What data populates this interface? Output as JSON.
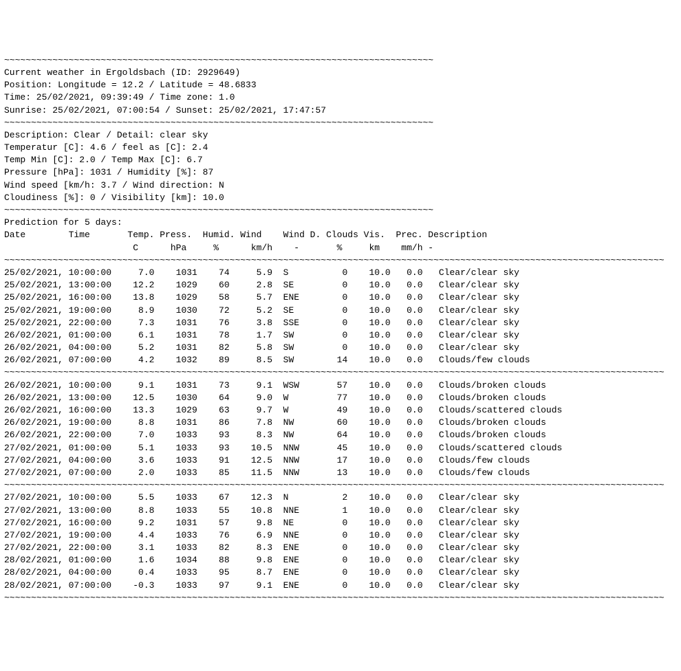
{
  "sep": "~~~~~~~~~~~~~~~~~~~~~~~~~~~~~~~~~~~~~~~~~~~~~~~~~~~~~~~~~~~~~~~~~~~~~~~~~~~~~~~~",
  "sep_long": "~~~~~~~~~~~~~~~~~~~~~~~~~~~~~~~~~~~~~~~~~~~~~~~~~~~~~~~~~~~~~~~~~~~~~~~~~~~~~~~~~~~~~~~~~~~~~~~~~~~~~~~~~~~~~~~~~~~~~~~~~~~",
  "header": {
    "title": "Current weather in Ergoldsbach (ID: 2929649)",
    "position": "Position: Longitude = 12.2 / Latitude = 48.6833",
    "time": "Time: 25/02/2021, 09:39:49 / Time zone: 1.0",
    "sun": "Sunrise: 25/02/2021, 07:00:54 / Sunset: 25/02/2021, 17:47:57"
  },
  "current": {
    "description": "Description: Clear / Detail: clear sky",
    "temp": "Temperatur [C]: 4.6 / feel as [C]: 2.4",
    "tempminmax": "Temp Min [C]: 2.0 / Temp Max [C]: 6.7",
    "pressure": "Pressure [hPa]: 1031 / Humidity [%]: 87",
    "wind": "Wind speed [km/h: 3.7 / Wind direction: N",
    "clouds": "Cloudiness [%]: 0 / Visibility [km]: 10.0"
  },
  "prediction_label": "Prediction for 5 days:",
  "columns": {
    "row1": [
      "Date",
      "Time",
      "Temp.",
      "Press.",
      "Humid.",
      "Wind",
      "Wind D.",
      "Clouds",
      "Vis.",
      "Prec.",
      "Description"
    ],
    "row2": [
      "",
      "",
      "C",
      "hPa",
      "%",
      "km/h",
      "-",
      "%",
      "km",
      "mm/h",
      "-"
    ]
  },
  "blocks": [
    [
      {
        "date": "25/02/2021,",
        "time": "10:00:00",
        "temp": "7.0",
        "press": "1031",
        "humid": "74",
        "wind": "5.9",
        "windd": "S",
        "clouds": "0",
        "vis": "10.0",
        "prec": "0.0",
        "desc": "Clear/clear sky"
      },
      {
        "date": "25/02/2021,",
        "time": "13:00:00",
        "temp": "12.2",
        "press": "1029",
        "humid": "60",
        "wind": "2.8",
        "windd": "SE",
        "clouds": "0",
        "vis": "10.0",
        "prec": "0.0",
        "desc": "Clear/clear sky"
      },
      {
        "date": "25/02/2021,",
        "time": "16:00:00",
        "temp": "13.8",
        "press": "1029",
        "humid": "58",
        "wind": "5.7",
        "windd": "ENE",
        "clouds": "0",
        "vis": "10.0",
        "prec": "0.0",
        "desc": "Clear/clear sky"
      },
      {
        "date": "25/02/2021,",
        "time": "19:00:00",
        "temp": "8.9",
        "press": "1030",
        "humid": "72",
        "wind": "5.2",
        "windd": "SE",
        "clouds": "0",
        "vis": "10.0",
        "prec": "0.0",
        "desc": "Clear/clear sky"
      },
      {
        "date": "25/02/2021,",
        "time": "22:00:00",
        "temp": "7.3",
        "press": "1031",
        "humid": "76",
        "wind": "3.8",
        "windd": "SSE",
        "clouds": "0",
        "vis": "10.0",
        "prec": "0.0",
        "desc": "Clear/clear sky"
      },
      {
        "date": "26/02/2021,",
        "time": "01:00:00",
        "temp": "6.1",
        "press": "1031",
        "humid": "78",
        "wind": "1.7",
        "windd": "SW",
        "clouds": "0",
        "vis": "10.0",
        "prec": "0.0",
        "desc": "Clear/clear sky"
      },
      {
        "date": "26/02/2021,",
        "time": "04:00:00",
        "temp": "5.2",
        "press": "1031",
        "humid": "82",
        "wind": "5.8",
        "windd": "SW",
        "clouds": "0",
        "vis": "10.0",
        "prec": "0.0",
        "desc": "Clear/clear sky"
      },
      {
        "date": "26/02/2021,",
        "time": "07:00:00",
        "temp": "4.2",
        "press": "1032",
        "humid": "89",
        "wind": "8.5",
        "windd": "SW",
        "clouds": "14",
        "vis": "10.0",
        "prec": "0.0",
        "desc": "Clouds/few clouds"
      }
    ],
    [
      {
        "date": "26/02/2021,",
        "time": "10:00:00",
        "temp": "9.1",
        "press": "1031",
        "humid": "73",
        "wind": "9.1",
        "windd": "WSW",
        "clouds": "57",
        "vis": "10.0",
        "prec": "0.0",
        "desc": "Clouds/broken clouds"
      },
      {
        "date": "26/02/2021,",
        "time": "13:00:00",
        "temp": "12.5",
        "press": "1030",
        "humid": "64",
        "wind": "9.0",
        "windd": "W",
        "clouds": "77",
        "vis": "10.0",
        "prec": "0.0",
        "desc": "Clouds/broken clouds"
      },
      {
        "date": "26/02/2021,",
        "time": "16:00:00",
        "temp": "13.3",
        "press": "1029",
        "humid": "63",
        "wind": "9.7",
        "windd": "W",
        "clouds": "49",
        "vis": "10.0",
        "prec": "0.0",
        "desc": "Clouds/scattered clouds"
      },
      {
        "date": "26/02/2021,",
        "time": "19:00:00",
        "temp": "8.8",
        "press": "1031",
        "humid": "86",
        "wind": "7.8",
        "windd": "NW",
        "clouds": "60",
        "vis": "10.0",
        "prec": "0.0",
        "desc": "Clouds/broken clouds"
      },
      {
        "date": "26/02/2021,",
        "time": "22:00:00",
        "temp": "7.0",
        "press": "1033",
        "humid": "93",
        "wind": "8.3",
        "windd": "NW",
        "clouds": "64",
        "vis": "10.0",
        "prec": "0.0",
        "desc": "Clouds/broken clouds"
      },
      {
        "date": "27/02/2021,",
        "time": "01:00:00",
        "temp": "5.1",
        "press": "1033",
        "humid": "93",
        "wind": "10.5",
        "windd": "NNW",
        "clouds": "45",
        "vis": "10.0",
        "prec": "0.0",
        "desc": "Clouds/scattered clouds"
      },
      {
        "date": "27/02/2021,",
        "time": "04:00:00",
        "temp": "3.6",
        "press": "1033",
        "humid": "91",
        "wind": "12.5",
        "windd": "NNW",
        "clouds": "17",
        "vis": "10.0",
        "prec": "0.0",
        "desc": "Clouds/few clouds"
      },
      {
        "date": "27/02/2021,",
        "time": "07:00:00",
        "temp": "2.0",
        "press": "1033",
        "humid": "85",
        "wind": "11.5",
        "windd": "NNW",
        "clouds": "13",
        "vis": "10.0",
        "prec": "0.0",
        "desc": "Clouds/few clouds"
      }
    ],
    [
      {
        "date": "27/02/2021,",
        "time": "10:00:00",
        "temp": "5.5",
        "press": "1033",
        "humid": "67",
        "wind": "12.3",
        "windd": "N",
        "clouds": "2",
        "vis": "10.0",
        "prec": "0.0",
        "desc": "Clear/clear sky"
      },
      {
        "date": "27/02/2021,",
        "time": "13:00:00",
        "temp": "8.8",
        "press": "1033",
        "humid": "55",
        "wind": "10.8",
        "windd": "NNE",
        "clouds": "1",
        "vis": "10.0",
        "prec": "0.0",
        "desc": "Clear/clear sky"
      },
      {
        "date": "27/02/2021,",
        "time": "16:00:00",
        "temp": "9.2",
        "press": "1031",
        "humid": "57",
        "wind": "9.8",
        "windd": "NE",
        "clouds": "0",
        "vis": "10.0",
        "prec": "0.0",
        "desc": "Clear/clear sky"
      },
      {
        "date": "27/02/2021,",
        "time": "19:00:00",
        "temp": "4.4",
        "press": "1033",
        "humid": "76",
        "wind": "6.9",
        "windd": "NNE",
        "clouds": "0",
        "vis": "10.0",
        "prec": "0.0",
        "desc": "Clear/clear sky"
      },
      {
        "date": "27/02/2021,",
        "time": "22:00:00",
        "temp": "3.1",
        "press": "1033",
        "humid": "82",
        "wind": "8.3",
        "windd": "ENE",
        "clouds": "0",
        "vis": "10.0",
        "prec": "0.0",
        "desc": "Clear/clear sky"
      },
      {
        "date": "28/02/2021,",
        "time": "01:00:00",
        "temp": "1.6",
        "press": "1034",
        "humid": "88",
        "wind": "9.8",
        "windd": "ENE",
        "clouds": "0",
        "vis": "10.0",
        "prec": "0.0",
        "desc": "Clear/clear sky"
      },
      {
        "date": "28/02/2021,",
        "time": "04:00:00",
        "temp": "0.4",
        "press": "1033",
        "humid": "95",
        "wind": "8.7",
        "windd": "ENE",
        "clouds": "0",
        "vis": "10.0",
        "prec": "0.0",
        "desc": "Clear/clear sky"
      },
      {
        "date": "28/02/2021,",
        "time": "07:00:00",
        "temp": "-0.3",
        "press": "1033",
        "humid": "97",
        "wind": "9.1",
        "windd": "ENE",
        "clouds": "0",
        "vis": "10.0",
        "prec": "0.0",
        "desc": "Clear/clear sky"
      }
    ]
  ],
  "widths": {
    "date": 12,
    "time": 11,
    "temp": 6,
    "press": 8,
    "humid": 7,
    "wind": 8,
    "windd": 8,
    "clouds": 7,
    "vis": 6,
    "prec": 6
  }
}
